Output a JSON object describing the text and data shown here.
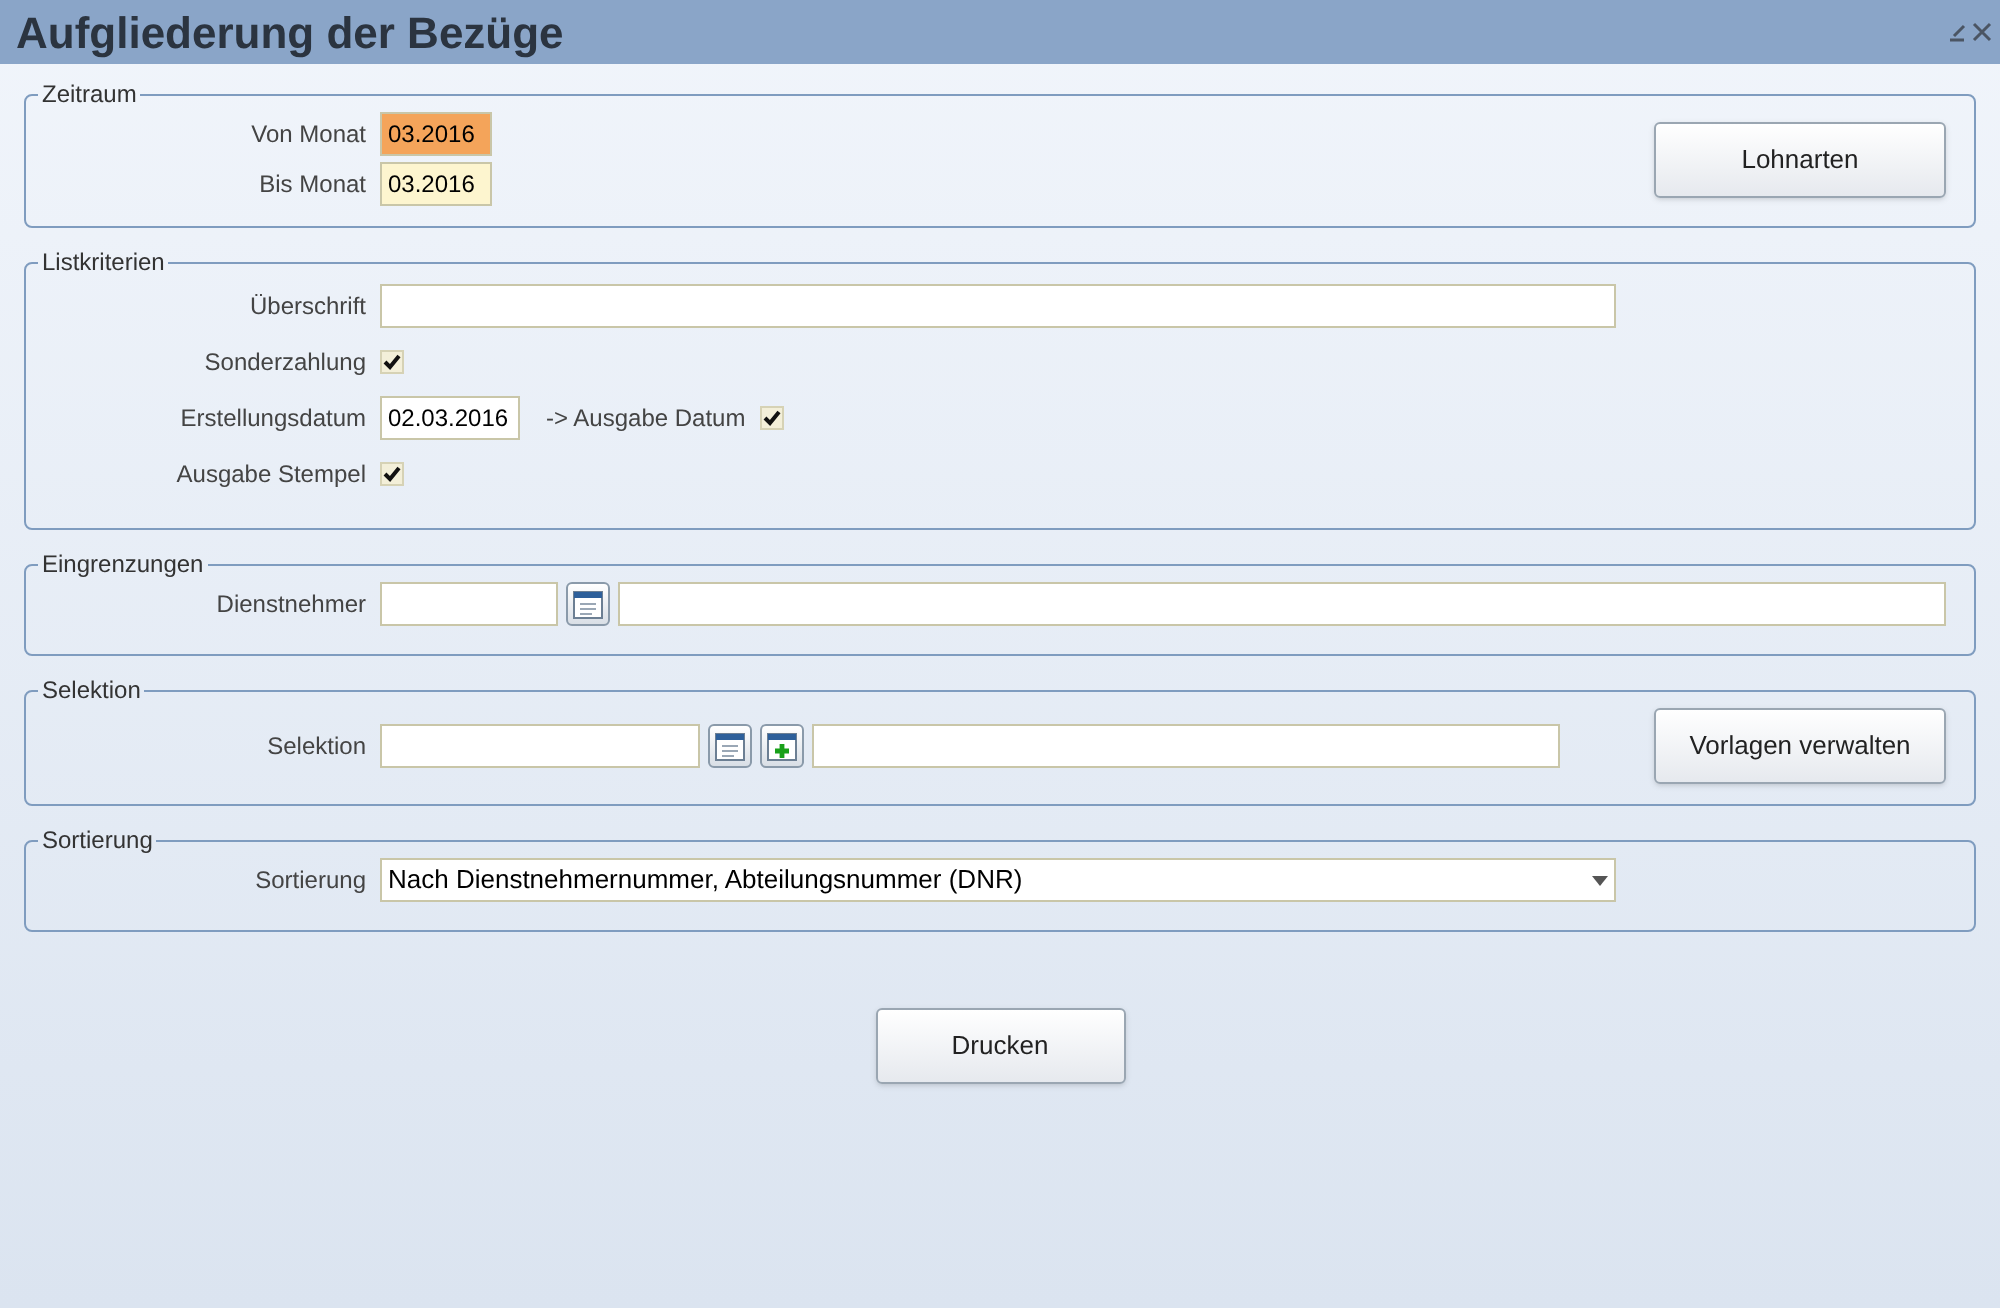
{
  "window": {
    "title": "Aufgliederung der Bezüge"
  },
  "zeitraum": {
    "title": "Zeitraum",
    "von_monat": {
      "label": "Von Monat",
      "value": "03.2016",
      "focused": true
    },
    "bis_monat": {
      "label": "Bis Monat",
      "value": "03.2016",
      "focused": false
    },
    "button": "Lohnarten"
  },
  "listkriterien": {
    "title": "Listkriterien",
    "ueberschrift": {
      "label": "Überschrift"
    },
    "sonderzahlung": {
      "label": "Sonderzahlung",
      "checked": true
    },
    "erstellungsdatum": {
      "label": "Erstellungsdatum",
      "value": "02.03.2016"
    },
    "ausgabe_datum": {
      "label": "-> Ausgabe Datum",
      "checked": true
    },
    "ausgabe_stempel": {
      "label": "Ausgabe Stempel",
      "checked": true
    }
  },
  "eingrenzungen": {
    "title": "Eingrenzungen",
    "dienstnehmer": {
      "label": "Dienstnehmer"
    }
  },
  "selektion": {
    "title": "Selektion",
    "selektion": {
      "label": "Selektion"
    },
    "button": "Vorlagen verwalten"
  },
  "sortierung": {
    "title": "Sortierung",
    "sortierung": {
      "label": "Sortierung",
      "value": "Nach Dienstnehmernummer, Abteilungsnummer (DNR)"
    }
  },
  "buttons": [
    "Drucken"
  ]
}
